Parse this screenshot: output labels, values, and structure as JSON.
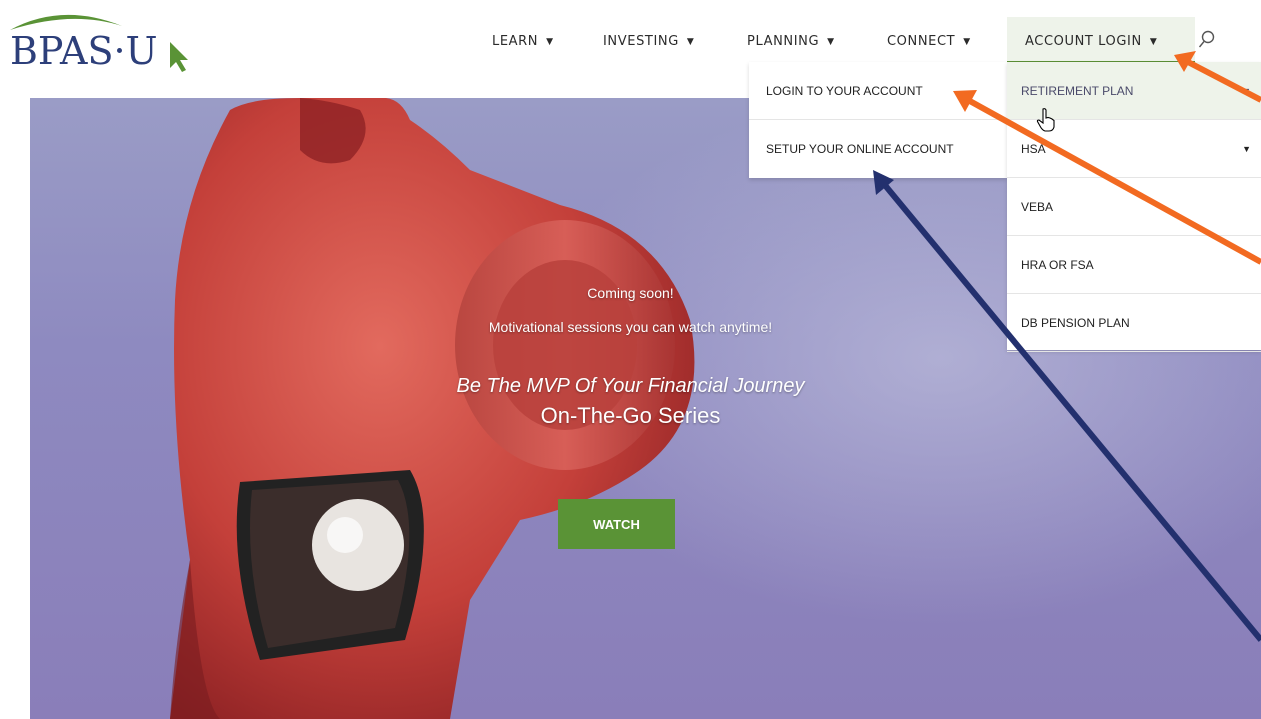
{
  "brand": {
    "logo_text": "BPAS·U"
  },
  "nav": {
    "learn": "LEARN",
    "investing": "INVESTING",
    "planning": "PLANNING",
    "connect": "CONNECT",
    "account_login": "ACCOUNT LOGIN",
    "caret": "▼"
  },
  "hero": {
    "coming_soon": "Coming soon!",
    "subtitle": "Motivational sessions you can watch anytime!",
    "headline": "Be The MVP Of Your Financial Journey",
    "series": "On-The-Go Series",
    "watch_label": "WATCH"
  },
  "login_menu": {
    "items": [
      "LOGIN TO YOUR ACCOUNT",
      "SETUP YOUR ONLINE ACCOUNT"
    ]
  },
  "account_menu": {
    "items": [
      "RETIREMENT PLAN",
      "HSA",
      "VEBA",
      "HRA OR FSA",
      "DB PENSION PLAN"
    ],
    "submenu_arrow": "▼"
  },
  "icons": [
    "search-icon",
    "hand-pointer-icon",
    "whistle-image",
    "annotation-arrow"
  ],
  "colors": {
    "brand_green": "#5a9336",
    "logo_blue": "#2d3f7a",
    "orange_arrow": "#f26a21",
    "navy_arrow": "#23306e",
    "hero_purple": "#8e8ac0"
  }
}
